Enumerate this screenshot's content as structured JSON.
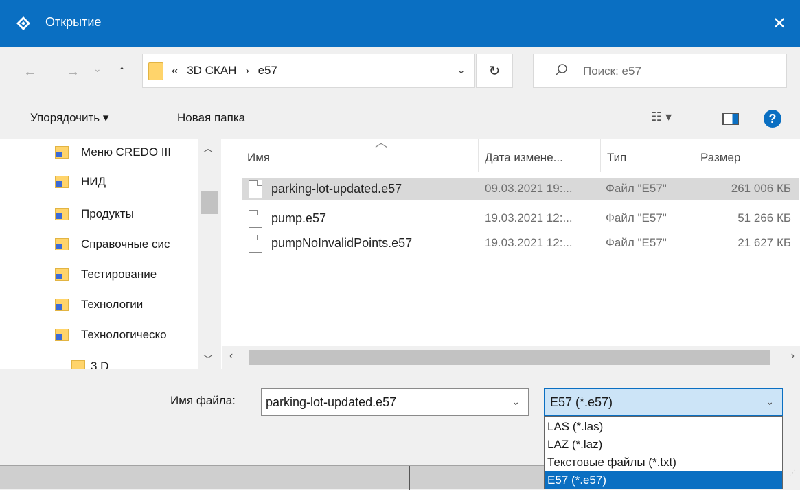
{
  "window": {
    "title": "Открытие",
    "close_label": "✕"
  },
  "nav": {
    "back": "←",
    "forward": "→",
    "recent": "⌄",
    "up": "↑",
    "breadcrumbs": [
      "«",
      "3D СКАН",
      "›",
      "e57"
    ],
    "refresh": "↻"
  },
  "search": {
    "placeholder": "Поиск: e57"
  },
  "toolbar": {
    "organize": "Упорядочить ▾",
    "new_folder": "Новая папка",
    "view": "☷ ▾",
    "help": "?"
  },
  "sidebar": {
    "items": [
      {
        "label": "Меню CREDO III"
      },
      {
        "label": "НИД"
      },
      {
        "label": "Продукты"
      },
      {
        "label": "Справочные сис"
      },
      {
        "label": "Тестирование"
      },
      {
        "label": "Технологии"
      },
      {
        "label": "Технологическо"
      },
      {
        "label": "3 D"
      }
    ]
  },
  "columns": {
    "name": "Имя",
    "date": "Дата измене...",
    "type": "Тип",
    "size": "Размер"
  },
  "files": [
    {
      "name": "parking-lot-updated.e57",
      "date": "09.03.2021 19:...",
      "type": "Файл \"E57\"",
      "size": "261 006 КБ",
      "selected": true
    },
    {
      "name": "pump.e57",
      "date": "19.03.2021 12:...",
      "type": "Файл \"E57\"",
      "size": "51 266 КБ",
      "selected": false
    },
    {
      "name": "pumpNoInvalidPoints.e57",
      "date": "19.03.2021 12:...",
      "type": "Файл \"E57\"",
      "size": "21 627 КБ",
      "selected": false
    }
  ],
  "footer": {
    "filename_label": "Имя файла:",
    "filename_value": "parking-lot-updated.e57",
    "filter_value": "E57 (*.e57)",
    "filter_options": [
      "LAS (*.las)",
      "LAZ (*.laz)",
      "Текстовые файлы (*.txt)",
      "E57 (*.e57)"
    ]
  },
  "colors": {
    "accent": "#0a6fc2",
    "selection": "#d9d9d9",
    "folder": "#ffd46b"
  }
}
